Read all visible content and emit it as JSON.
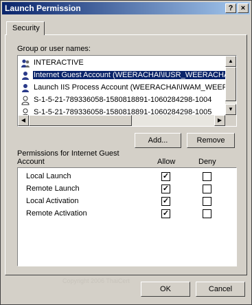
{
  "window": {
    "title": "Launch Permission",
    "help_label": "?",
    "close_label": "×"
  },
  "tabs": [
    {
      "label": "Security"
    }
  ],
  "group": {
    "label": "Group or user names:",
    "items": [
      {
        "label": "INTERACTIVE",
        "icon": "users-group-icon",
        "selected": false
      },
      {
        "label": "Internet Guest Account (WEERACHAI\\IUSR_WEERACHAI",
        "icon": "user-icon",
        "selected": true
      },
      {
        "label": "Launch IIS Process Account (WEERACHAI\\IWAM_WEERA",
        "icon": "user-icon",
        "selected": false
      },
      {
        "label": "S-1-5-21-789336058-1580818891-1060284298-1004",
        "icon": "unknown-user-icon",
        "selected": false
      },
      {
        "label": "S-1-5-21-789336058-1580818891-1060284298-1005",
        "icon": "unknown-user-icon",
        "selected": false
      }
    ]
  },
  "buttons": {
    "add": "Add...",
    "remove": "Remove",
    "ok": "OK",
    "cancel": "Cancel"
  },
  "permissions": {
    "label_line1": "Permissions for Internet Guest",
    "label_line2": "Account",
    "allow_header": "Allow",
    "deny_header": "Deny",
    "rows": [
      {
        "name": "Local Launch",
        "allow": true,
        "deny": false
      },
      {
        "name": "Remote Launch",
        "allow": true,
        "deny": false
      },
      {
        "name": "Local Activation",
        "allow": true,
        "deny": false
      },
      {
        "name": "Remote Activation",
        "allow": true,
        "deny": false
      }
    ]
  },
  "scroll_arrows": {
    "up": "▲",
    "down": "▼",
    "left": "◀",
    "right": "▶"
  },
  "watermark": "Copyright 2006 ThaiCert"
}
